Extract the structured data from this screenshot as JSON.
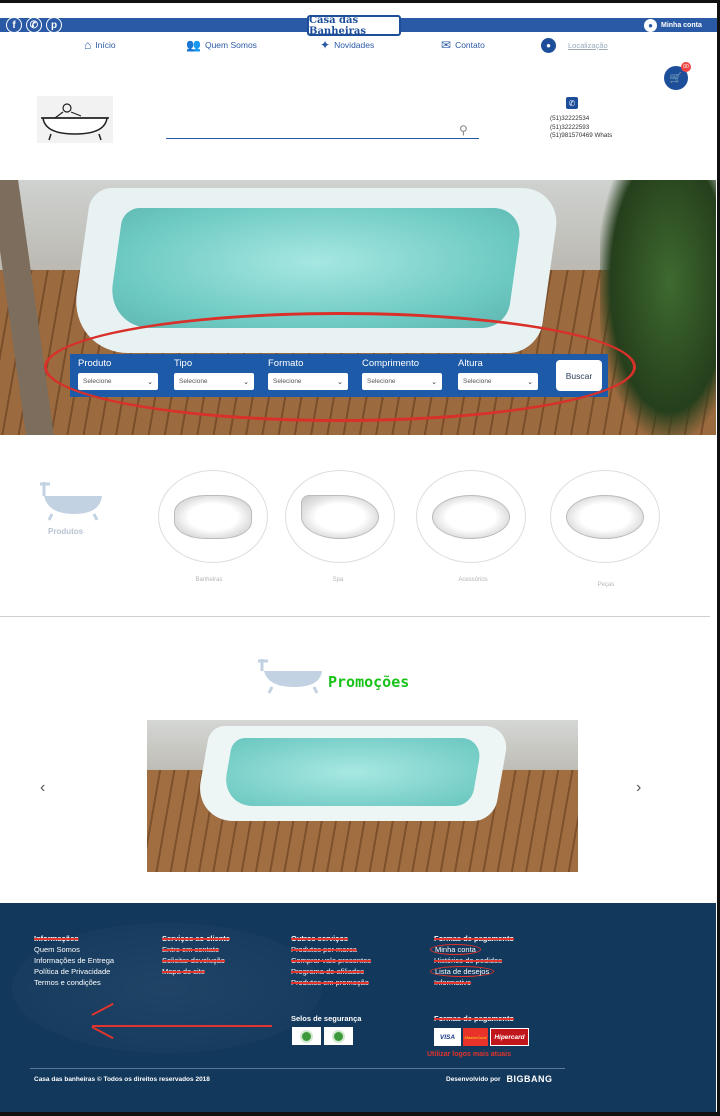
{
  "topbar": {
    "brand": "Casa das Banheiras",
    "account_label": "Minha conta",
    "social": [
      {
        "icon": "facebook-icon",
        "glyph": "f"
      },
      {
        "icon": "whatsapp-icon",
        "glyph": "✆"
      },
      {
        "icon": "pinterest-icon",
        "glyph": "p"
      }
    ]
  },
  "nav": {
    "items": [
      "Início",
      "Quem Somos",
      "Novidades",
      "Contato"
    ],
    "location": "Localização",
    "cart_count": "00"
  },
  "header": {
    "phones": [
      "(51)32222534",
      "(51)32222593",
      "(51)981570469 Whats"
    ]
  },
  "filters": {
    "fields": [
      {
        "label": "Produto",
        "value": "Selecione"
      },
      {
        "label": "Tipo",
        "value": "Selecione"
      },
      {
        "label": "Formato",
        "value": "Selecione"
      },
      {
        "label": "Comprimento",
        "value": "Selecione"
      },
      {
        "label": "Altura",
        "value": "Selecione"
      }
    ],
    "search_button": "Buscar"
  },
  "products": {
    "label": "Produtos",
    "categories": [
      "Banheiras",
      "Spa",
      "Acessórios",
      "Peças"
    ]
  },
  "promo": {
    "title": "Promoções"
  },
  "footer": {
    "columns": [
      {
        "heading": "Informações",
        "items": [
          "Quem Somos",
          "Informações de Entrega",
          "Política de Privacidade",
          "Termos e condições"
        ]
      },
      {
        "heading": "Serviços ao cliente",
        "items": [
          "Entre em contato",
          "Solicitar devolução",
          "Mapa do site"
        ]
      },
      {
        "heading": "Outros serviços",
        "items": [
          "Produtos por marca",
          "Comprar vale presentes",
          "Programa de afiliados",
          "Produtos em promoção"
        ]
      },
      {
        "heading": "Formas de pagamento",
        "items": [
          "Minha conta",
          "Histórico de pedidos",
          "Lista de desejos",
          "Informativo"
        ]
      }
    ],
    "security_heading": "Selos de segurança",
    "payment_heading": "Formas de pagamento",
    "payment_logos": [
      "VISA",
      "MasterCard",
      "Hipercard"
    ],
    "note": "Utilizar logos mais atuais",
    "copyright": "Casa das banheiras © Todos os direitos reservados 2018",
    "developed_by": "Desenvolvido por",
    "developer": "BIGBANG"
  },
  "colors": {
    "brand_blue": "#2a5aa6",
    "filter_blue": "#1d5aa8",
    "footer_bg": "#12385c",
    "promo_green": "#19c219",
    "annotation_red": "#d9302a"
  }
}
